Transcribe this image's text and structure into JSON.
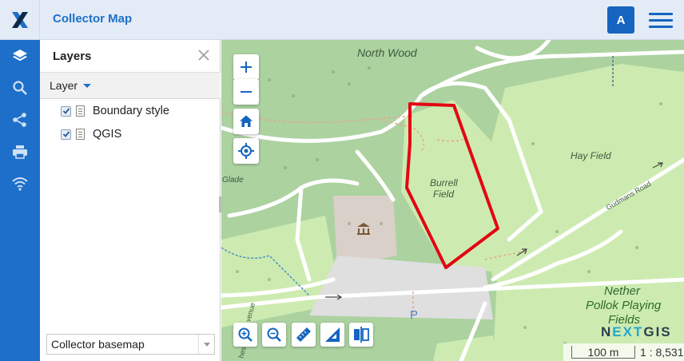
{
  "header": {
    "app_title": "Collector Map",
    "avatar_letter": "A",
    "logo_icon": "nextgis-x-icon",
    "menu_icon": "hamburger-icon"
  },
  "sidebar": {
    "items": [
      {
        "icon": "layers-icon",
        "active": true
      },
      {
        "icon": "search-icon",
        "active": false
      },
      {
        "icon": "share-icon",
        "active": false
      },
      {
        "icon": "print-icon",
        "active": false
      },
      {
        "icon": "wifi-icon",
        "active": false
      }
    ]
  },
  "layers_panel": {
    "title": "Layers",
    "layer_dropdown_label": "Layer",
    "layers": [
      {
        "name": "Boundary style",
        "checked": true
      },
      {
        "name": "QGIS",
        "checked": true
      }
    ],
    "basemap_select": "Collector basemap"
  },
  "map": {
    "labels": {
      "north_wood": "North Wood",
      "hay_field": "Hay Field",
      "burrell_field_1": "Burrell",
      "burrell_field_2": "Field",
      "glade": "Glade",
      "road": "Gudmans Road",
      "nether_1": "Nether",
      "nether_2": "Pollok Playing",
      "nether_3": "Fields",
      "parking": "P",
      "venue": "venue",
      "chest": "hest"
    },
    "brand_prefix": "N",
    "brand_mid": "EXT",
    "brand_suffix": "GIS",
    "scale_label": "100 m",
    "scale_ratio": "1 : 8,531",
    "boundary_color": "#e30613",
    "controls": [
      "zoom-in",
      "zoom-out",
      "home",
      "locate"
    ],
    "tools": [
      "zoom-in-box",
      "zoom-out-box",
      "measure-distance",
      "measure-area",
      "swipe"
    ]
  }
}
